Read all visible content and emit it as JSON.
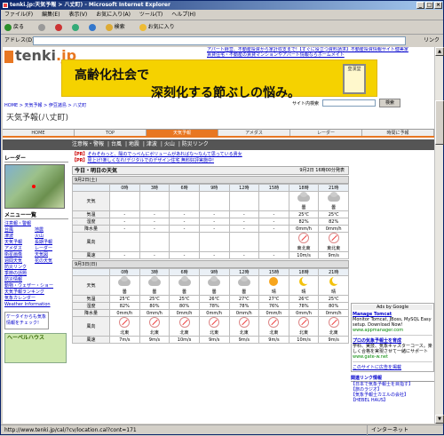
{
  "window": {
    "title": "tenki.jp:天気予報 > 八丈町) - Microsoft Internet Explorer"
  },
  "menu": [
    "ファイル(F)",
    "編集(E)",
    "表示(V)",
    "お気に入り(A)",
    "ツール(T)",
    "ヘルプ(H)"
  ],
  "toolbar": {
    "back": "戻る",
    "search": "検索",
    "favorites": "お気に入り"
  },
  "address": {
    "label": "アドレス(D)",
    "link": "リンク"
  },
  "status": {
    "url": "http://www.tenki.jp/cal/?cv/location.cal?cont=171",
    "zone": "インターネット"
  },
  "page": {
    "logo_main": "tenki",
    "logo_jp": ".jp",
    "top_links": [
      "アパート経営、不動産投資から家計収支まで!【すぐに役立つ資料請求】不動産投資情報サイト健美家",
      "賃貸住宅・不動産の賃貸マンションやアパート情報ならホームメイト"
    ],
    "banner": {
      "line1": "高齢化社会で",
      "line2": "深刻化する節ぶしの悩み。",
      "stamp": "皇漢堂"
    },
    "breadcrumb": "HOME > 天気予報 > 伊豆諸島 > 八丈町",
    "site_search_label": "サイト内検索",
    "site_search_button": "検索",
    "title": "天気予報(八丈町)",
    "tabs": [
      "HOME",
      "TOP",
      "天気予報",
      "アメダス",
      "レーダー",
      "時間に予報"
    ],
    "subnav": [
      "注意報・警報",
      "台風",
      "地震",
      "津波",
      "火山",
      "防災リンク"
    ],
    "side": {
      "radar_heading": "レーダー",
      "menu_heading": "メニュー一覧",
      "links_pairs": [
        [
          "注意報・警報",
          ""
        ],
        [
          "台風",
          "地震"
        ],
        [
          "津波",
          "火山"
        ],
        [
          "天気予報",
          "長期予報"
        ],
        [
          "アメダス",
          "レーダー"
        ],
        [
          "衛星画像",
          "天気図"
        ],
        [
          "週間天気",
          "花の天気"
        ]
      ],
      "links_single": [
        "防災リンク",
        "季節の話題",
        "防災情報",
        "動物・ウェザー・ショー",
        "天気予報ランキング",
        "気象カレンダー",
        "Weather Information"
      ],
      "keitai": "ケータイからも気象情報をチェック!",
      "hebel": "ヘーベルハウス"
    },
    "pr": [
      {
        "tag": "【PR】",
        "text": "そわそわっと、陽のでっぺんにボリュームがあればな〜なんて思っている貴女"
      },
      {
        "tag": "【PR】",
        "text": "見上げ!楽しくなれ!デジタルでのデザイン住宅 無料好評実施中!"
      }
    ],
    "today_heading": "今日・明日の天気",
    "updated": "9月2日  16時00分発表",
    "days": [
      {
        "date": "9月2日(土)",
        "hours": [
          "0時",
          "3時",
          "6時",
          "9時",
          "12時",
          "15時",
          "18時",
          "21時"
        ],
        "weather": [
          "",
          "",
          "",
          "",
          "",
          "",
          "曇",
          "曇"
        ],
        "temp": [
          "-",
          "-",
          "-",
          "-",
          "-",
          "-",
          "25℃",
          "25℃"
        ],
        "humidity": [
          "-",
          "-",
          "-",
          "-",
          "-",
          "-",
          "82%",
          "82%"
        ],
        "rain": [
          "-",
          "-",
          "-",
          "-",
          "-",
          "-",
          "0mm/h",
          "0mm/h"
        ],
        "wind_dir": [
          "",
          "",
          "",
          "",
          "",
          "",
          "東北東",
          "東北東"
        ],
        "wind_speed": [
          "-",
          "-",
          "-",
          "-",
          "-",
          "-",
          "10m/s",
          "9m/s"
        ]
      },
      {
        "date": "9月3日(日)",
        "hours": [
          "0時",
          "3時",
          "6時",
          "9時",
          "12時",
          "15時",
          "18時",
          "21時"
        ],
        "weather": [
          "曇",
          "曇",
          "曇",
          "曇",
          "曇",
          "晴",
          "晴",
          "晴"
        ],
        "temp": [
          "25℃",
          "25℃",
          "25℃",
          "26℃",
          "27℃",
          "27℃",
          "26℃",
          "25℃"
        ],
        "humidity": [
          "82%",
          "80%",
          "80%",
          "78%",
          "78%",
          "76%",
          "78%",
          "80%"
        ],
        "rain": [
          "0mm/h",
          "0mm/h",
          "0mm/h",
          "0mm/h",
          "0mm/h",
          "0mm/h",
          "0mm/h",
          "0mm/h"
        ],
        "wind_dir": [
          "北東",
          "北東",
          "北東",
          "北東",
          "北東",
          "北東",
          "北東",
          "北東"
        ],
        "wind_speed": [
          "7m/s",
          "9m/s",
          "10m/s",
          "9m/s",
          "9m/s",
          "9m/s",
          "10m/s",
          "9m/s"
        ]
      }
    ],
    "labels": {
      "weather": "天気",
      "temp": "気温",
      "humidity": "湿度",
      "rain": "降水量",
      "wind_dir": "風向",
      "wind_speed": "風速"
    },
    "ads": {
      "heading": "Ads by Google",
      "items": [
        {
          "title": "Manage Tomcat",
          "desc": "Monitor Tomcat, JBoss, MySQL Easy setup. Download Now!",
          "url": "www.appmanager.com"
        },
        {
          "title": "プロの気象予報士を育成",
          "desc": "学科、実技、気象キャスターコース。楽しく合格を実現させて一緒にサポート",
          "url": "www.gate-w.net"
        }
      ],
      "footer": "このサイトに広告を掲載"
    },
    "related": {
      "heading": "関連リンク情報",
      "items": [
        "【日本で気象予報士を目指す】",
        "【旅のラジオ】",
        "【気象予報士カエルの会社】",
        "【HEBEL HAUS】"
      ]
    }
  }
}
